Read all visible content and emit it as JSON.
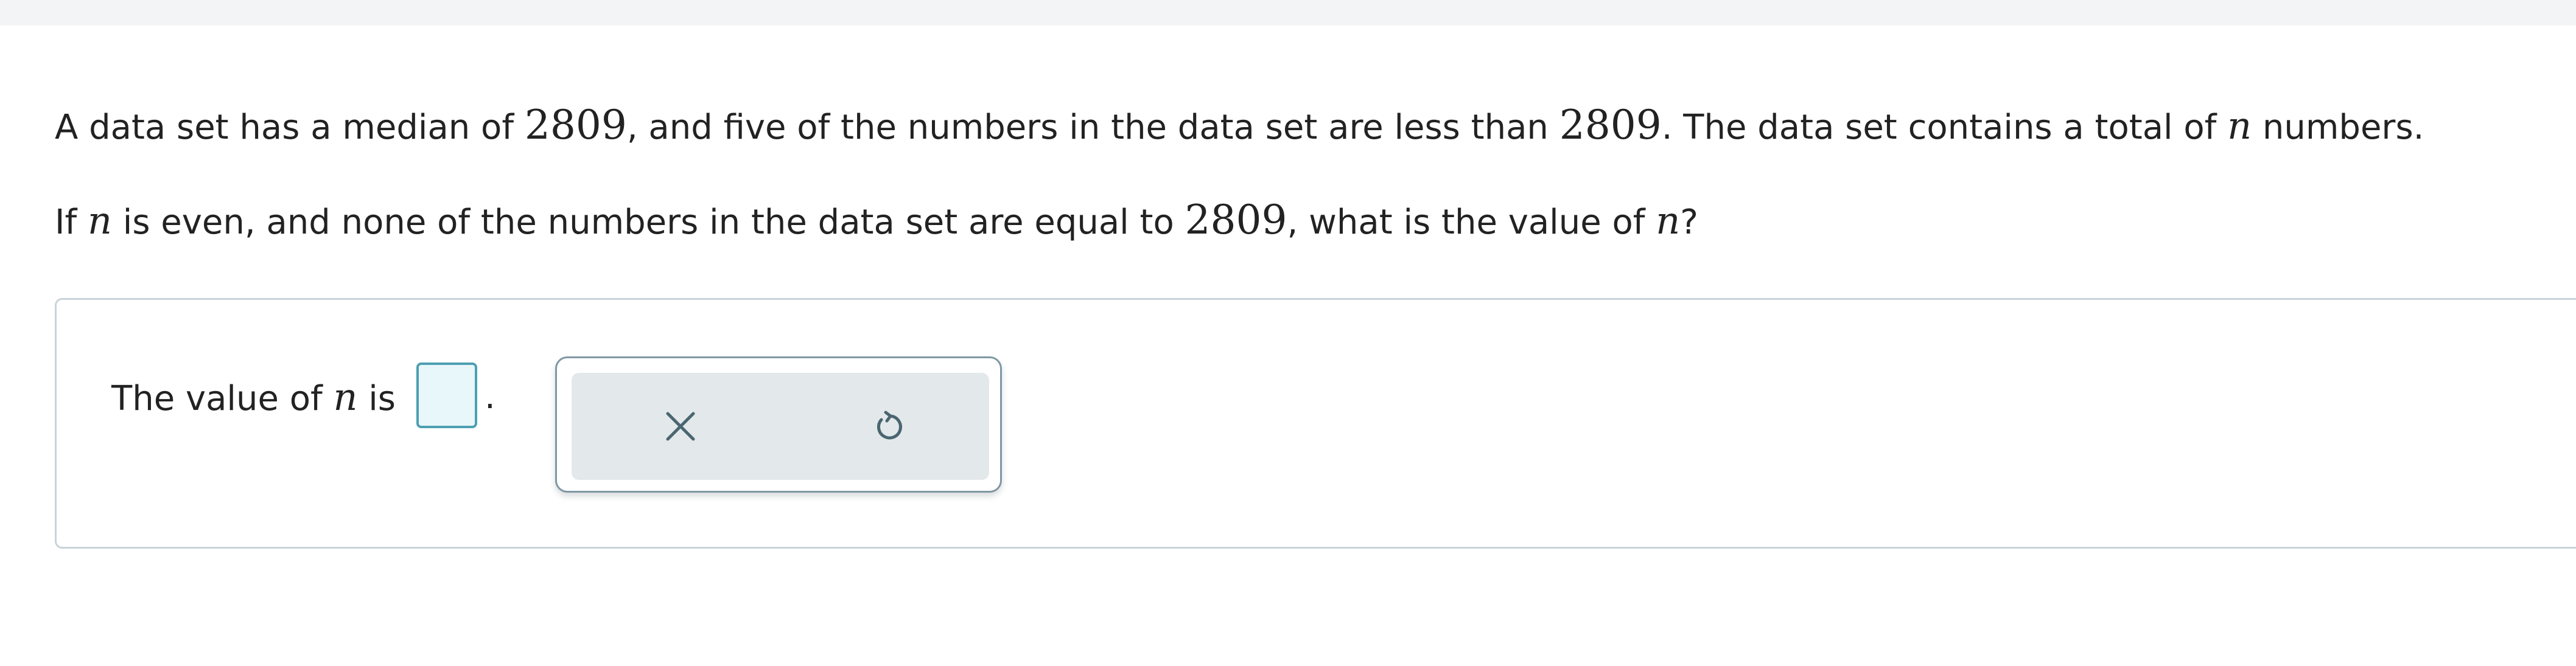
{
  "question": {
    "line1": {
      "part1": "A data set has a median of ",
      "median": "2809",
      "part2": ", and five of the numbers in the data set are less than ",
      "median_again": "2809",
      "part3": ". The data set contains a total of ",
      "variable": "n",
      "part4": " numbers."
    },
    "line2": {
      "part1": "If ",
      "variable": "n",
      "part2": " is even, and none of the numbers in the data set are equal to ",
      "median": "2809",
      "part3": ", what is the value of ",
      "variable_again": "n",
      "part4": "?"
    }
  },
  "answer": {
    "label_prefix": "The value of ",
    "variable": "n",
    "label_suffix": " is",
    "input_value": "",
    "period": "."
  },
  "tools": {
    "clear_icon": "x-icon",
    "reset_icon": "undo-icon"
  },
  "colors": {
    "top_strip": "#f3f4f6",
    "panel_border": "#c9d3d8",
    "input_border": "#4e9fb2",
    "input_fill": "#e8f7fa",
    "tool_border": "#7f98a3",
    "tool_fill": "#e3e8ea",
    "icon": "#4a6670"
  }
}
